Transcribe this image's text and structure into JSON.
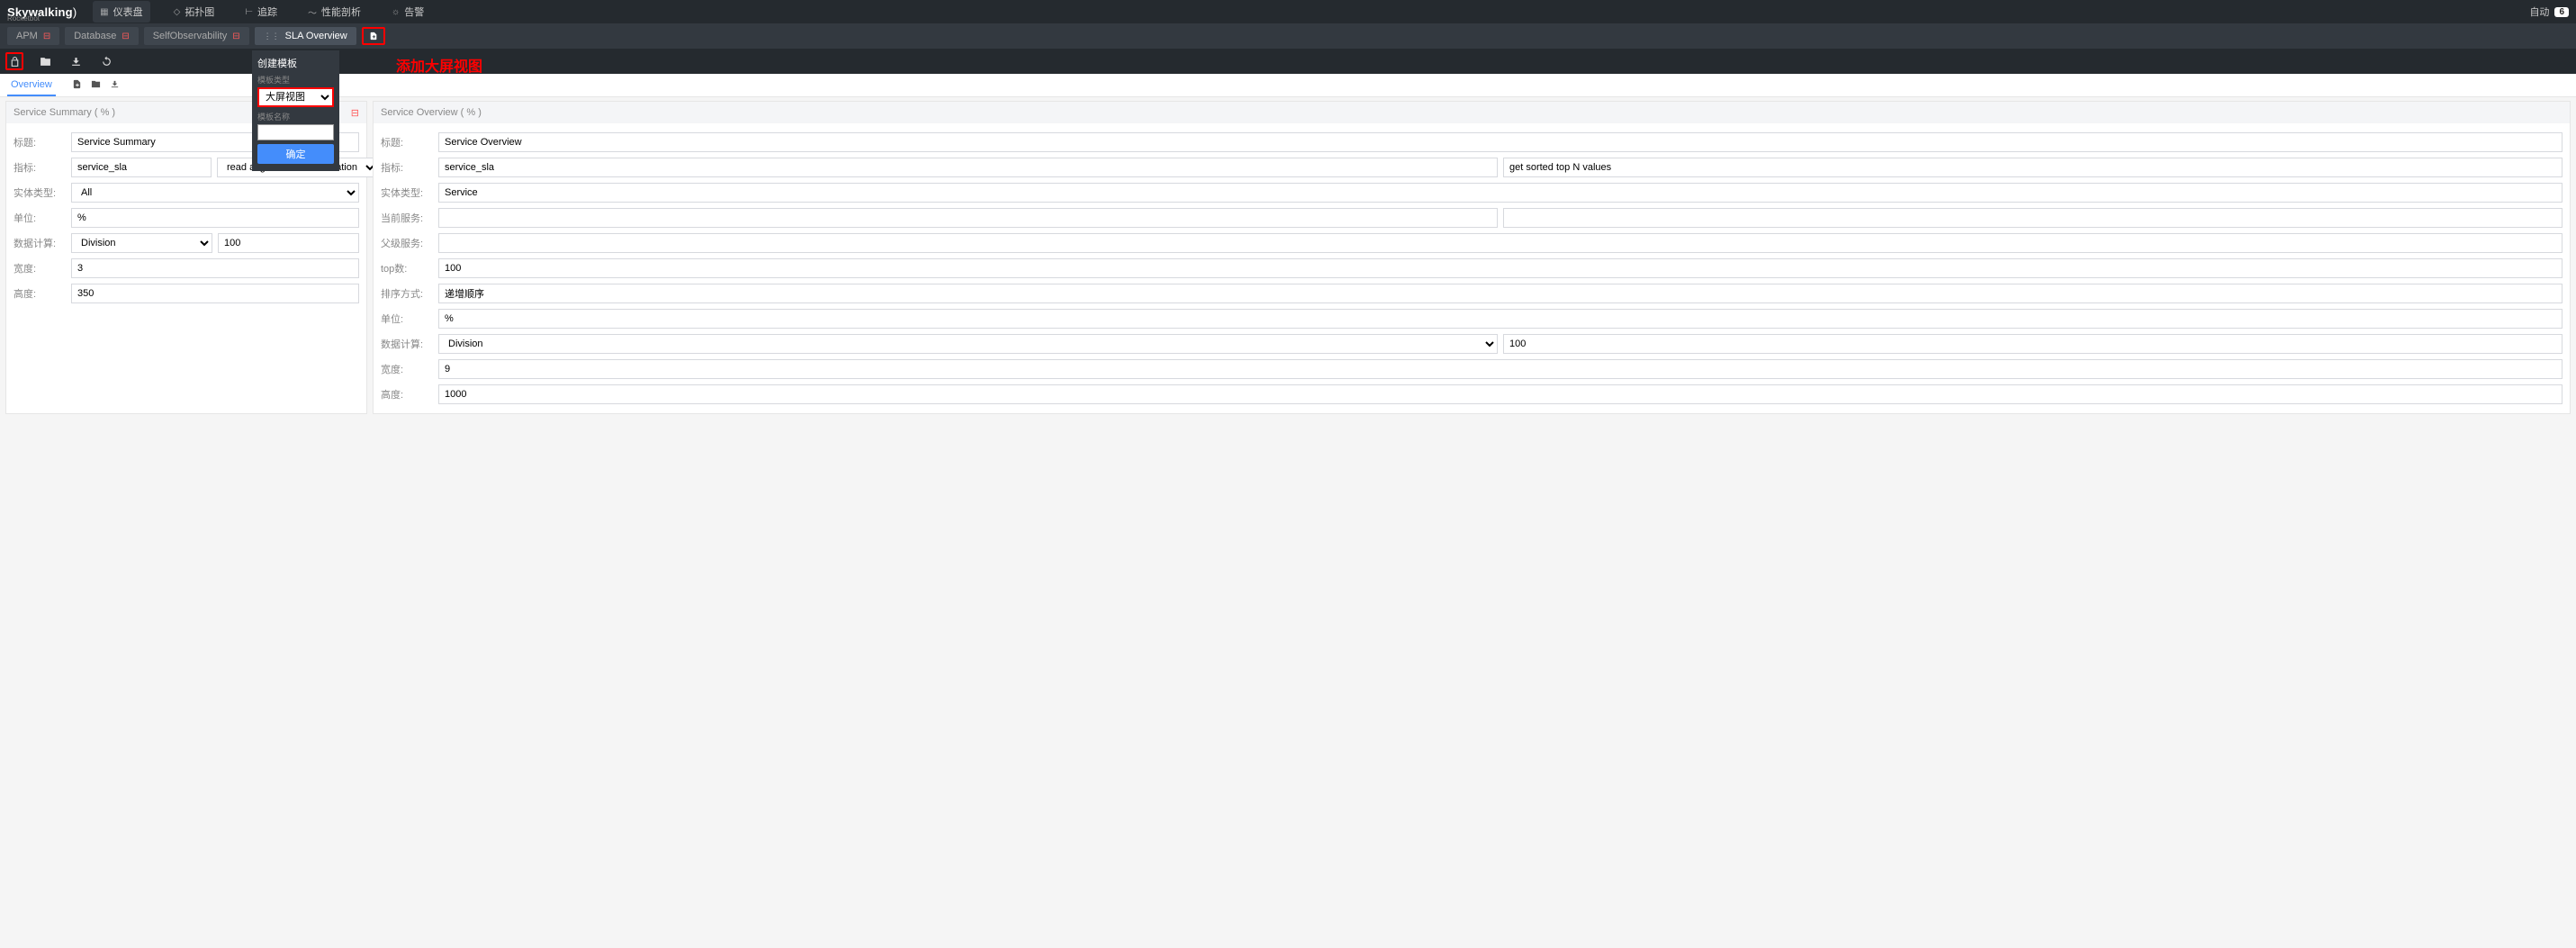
{
  "brand": {
    "main": "Skywalking",
    "sub": "Rocketbot"
  },
  "topnav": {
    "dashboard": "仪表盘",
    "topology": "拓扑图",
    "trace": "追踪",
    "profile": "性能剖析",
    "alarm": "告警"
  },
  "topright": {
    "auto": "自动",
    "count": "6"
  },
  "tabs": {
    "apm": "APM",
    "database": "Database",
    "self": "SelfObservability",
    "sla": "SLA Overview"
  },
  "annotation": "添加大屏视图",
  "popover": {
    "title": "创建模板",
    "type_label": "模板类型",
    "type_value": "大屏视图",
    "name_label": "模板名称",
    "name_value": "",
    "ok": "确定"
  },
  "subtab": {
    "overview": "Overview"
  },
  "left_panel": {
    "header": "Service Summary ( % )",
    "title_label": "标题:",
    "title_value": "Service Summary",
    "metric_label": "指标:",
    "metric_value": "service_sla",
    "metric_mode": "read avg value in the duration",
    "entity_label": "实体类型:",
    "entity_value": "All",
    "unit_label": "单位:",
    "unit_value": "%",
    "calc_label": "数据计算:",
    "calc_method": "Division",
    "calc_arg": "100",
    "width_label": "宽度:",
    "width_value": "3",
    "height_label": "高度:",
    "height_value": "350"
  },
  "right_panel": {
    "header": "Service Overview ( % )",
    "title_label": "标题:",
    "title_value": "Service Overview",
    "metric_label": "指标:",
    "metric_value": "service_sla",
    "metric_mode": "get sorted top N values",
    "entity_label": "实体类型:",
    "entity_value": "Service",
    "current_svc_label": "当前服务:",
    "current_svc_value": "",
    "parent_svc_label": "父级服务:",
    "parent_svc_value": "",
    "topn_label": "top数:",
    "topn_value": "100",
    "sort_label": "排序方式:",
    "sort_value": "递增顺序",
    "unit_label": "单位:",
    "unit_value": "%",
    "calc_label": "数据计算:",
    "calc_method": "Division",
    "calc_arg": "100",
    "width_label": "宽度:",
    "width_value": "9",
    "height_label": "高度:",
    "height_value": "1000"
  }
}
